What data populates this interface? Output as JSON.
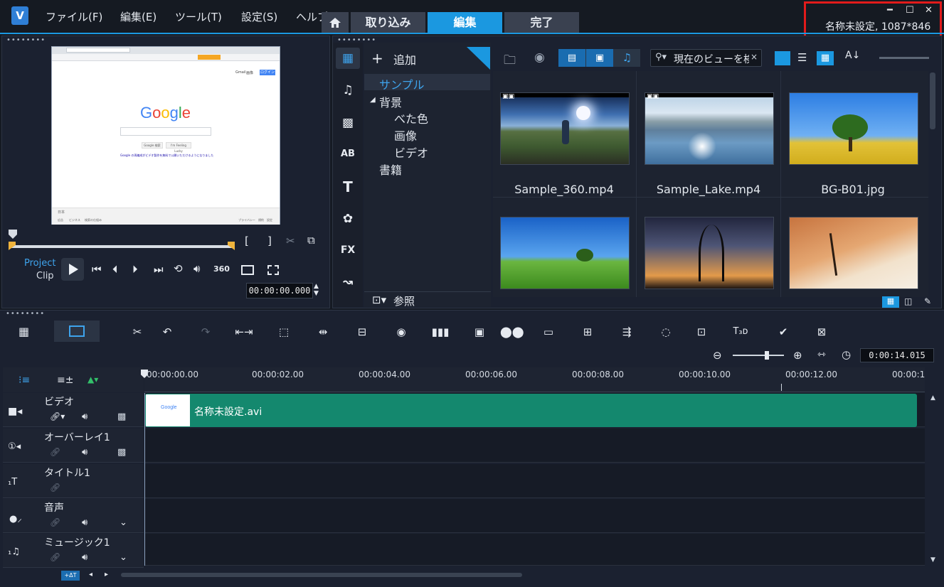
{
  "menubar": {
    "logo": "V",
    "items": [
      "ファイル(F)",
      "編集(E)",
      "ツール(T)",
      "設定(S)",
      "ヘルプ"
    ],
    "tabs": [
      "取り込み",
      "編集",
      "完了"
    ],
    "active_tab": "編集",
    "project_info": "名称未設定, 1087*846"
  },
  "preview": {
    "mode_project": "Project",
    "mode_clip": "Clip",
    "timecode": "00:00:00.000",
    "vr_label": "360",
    "screenshot": {
      "brand": "Google",
      "search_button": "Google 検索",
      "lucky_button": "I'm Feeling Lucky",
      "notice": "Google の再編成がビデオ製作を無料で公開いただけるようになりました",
      "footer_left": "日本",
      "footer_links": [
        "広告",
        "ビジネス",
        "検索の仕組み"
      ],
      "footer_right": [
        "プライバシー",
        "規約",
        "設定"
      ],
      "topbar_right": [
        "Gmail",
        "画像"
      ],
      "login": "ログイン"
    }
  },
  "library": {
    "add_label": "追加",
    "browse_label": "参照",
    "search_placeholder": "現在のビューを検索",
    "tree": [
      {
        "label": "サンプル",
        "level": 0,
        "selected": true
      },
      {
        "label": "背景",
        "level": 0,
        "expanded": true
      },
      {
        "label": "べた色",
        "level": 1
      },
      {
        "label": "画像",
        "level": 1
      },
      {
        "label": "ビデオ",
        "level": 1
      },
      {
        "label": "書籍",
        "level": 0
      }
    ],
    "side_icons": [
      "media-icon",
      "music-icon",
      "transition-icon",
      "graphic-icon",
      "title-icon",
      "decoration-icon",
      "fx-icon",
      "path-icon"
    ],
    "thumbnails": [
      {
        "label": "Sample_360.mp4",
        "scene": "360"
      },
      {
        "label": "Sample_Lake.mp4",
        "scene": "lake"
      },
      {
        "label": "BG-B01.jpg",
        "scene": "tree-yellow"
      },
      {
        "label": "",
        "scene": "green-hill"
      },
      {
        "label": "",
        "scene": "sunset"
      },
      {
        "label": "",
        "scene": "desert"
      }
    ]
  },
  "timeline": {
    "zoom_timecode": "0:00:14.015",
    "ruler": [
      "00:00:00.00",
      "00:00:02.00",
      "00:00:04.00",
      "00:00:06.00",
      "00:00:08.00",
      "00:00:10.00",
      "00:00:12.00",
      "00:00:1"
    ],
    "tracks": [
      {
        "name": "ビデオ"
      },
      {
        "name": "オーバーレイ1"
      },
      {
        "name": "タイトル1"
      },
      {
        "name": "音声"
      },
      {
        "name": "ミュージック1"
      }
    ],
    "clip": {
      "label": "名称未設定.avi",
      "color": "#14886e"
    },
    "add_track_label": "+ΔT"
  }
}
